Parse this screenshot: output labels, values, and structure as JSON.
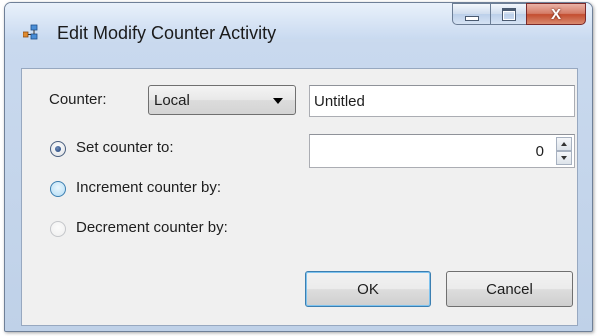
{
  "window": {
    "title": "Edit Modify Counter Activity",
    "controls": {
      "minimize": "minimize",
      "maximize": "maximize",
      "close": "X"
    }
  },
  "form": {
    "counter_label": "Counter:",
    "counter_select": {
      "selected": "Local"
    },
    "counter_name": {
      "value": "Untitled"
    },
    "options": [
      {
        "label": "Set counter to:",
        "checked": true
      },
      {
        "label": "Increment counter by:",
        "checked": false
      },
      {
        "label": "Decrement counter by:",
        "checked": false
      }
    ],
    "counter_value": "0"
  },
  "buttons": {
    "ok": "OK",
    "cancel": "Cancel"
  },
  "colors": {
    "title_bar": "#dbe7f5",
    "close_button": "#c34d2f",
    "client_bg": "#f0f0f0",
    "default_button_border": "#3c7fb1"
  }
}
